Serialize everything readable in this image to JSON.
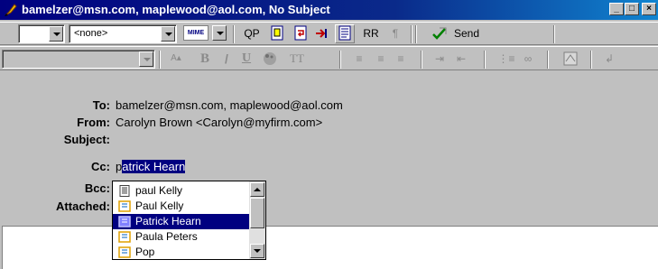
{
  "window": {
    "title": "bamelzer@msn.com, maplewood@aol.com, No Subject",
    "icon": "pen-icon",
    "controls": [
      "_",
      "□",
      "×"
    ]
  },
  "toolbar1": {
    "combo1_value": "",
    "combo2_value": "<none>",
    "mime_label": "MIME",
    "qp_label": "QP",
    "rr_label": "RR",
    "pilcrow_glyph": "¶",
    "send_label": "Send"
  },
  "toolbar2": {
    "font_combo_value": "",
    "bold_glyph": "B",
    "italic_glyph": "/",
    "underline_glyph": "U",
    "tt_label": "TT"
  },
  "header": {
    "to_label": "To:",
    "to_value": "bamelzer@msn.com, maplewood@aol.com",
    "from_label": "From:",
    "from_value": "Carolyn Brown <Carolyn@myfirm.com>",
    "subject_label": "Subject:",
    "subject_value": "",
    "cc_label": "Cc:",
    "cc_typed": "p",
    "cc_selected": "atrick Hearn",
    "bcc_label": "Bcc:",
    "attached_label": "Attached:"
  },
  "autocomplete": {
    "items": [
      {
        "label": "paul Kelly",
        "icon": "document-icon"
      },
      {
        "label": "Paul Kelly",
        "icon": "contact-card-icon"
      },
      {
        "label": "Patrick Hearn",
        "icon": "contact-card-icon"
      },
      {
        "label": "Paula Peters",
        "icon": "contact-card-icon"
      },
      {
        "label": "Pop",
        "icon": "contact-card-icon"
      }
    ],
    "selected_index": 2
  },
  "colors": {
    "titlebar": "#000080",
    "selection": "#000080",
    "face": "#c0c0c0"
  }
}
